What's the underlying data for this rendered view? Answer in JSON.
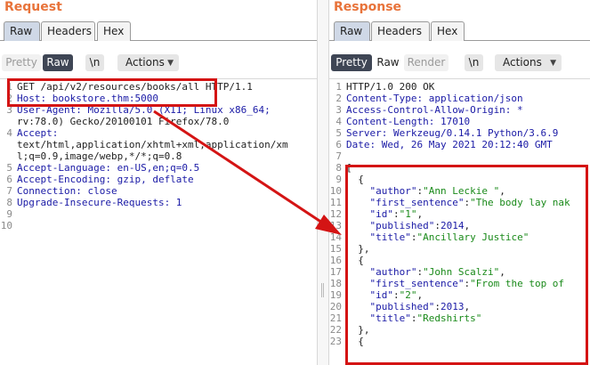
{
  "request": {
    "title": "Request",
    "tabs": [
      {
        "label": "Raw",
        "active": true
      },
      {
        "label": "Headers",
        "active": false
      },
      {
        "label": "Hex",
        "active": false
      }
    ],
    "view_buttons": [
      {
        "label": "Pretty",
        "state": "inactive"
      },
      {
        "label": "Raw",
        "state": "selected"
      }
    ],
    "newline_label": "\\n",
    "actions_label": "Actions",
    "lines": [
      {
        "n": "1",
        "text": "GET /api/v2/resources/books/all HTTP/1.1",
        "kind": "text"
      },
      {
        "n": "2",
        "text": "Host: bookstore.thm:5000",
        "kind": "header"
      },
      {
        "n": "3",
        "text": "User-Agent: Mozilla/5.0 (X11; Linux x86_64;",
        "kind": "header"
      },
      {
        "n": "",
        "text": "rv:78.0) Gecko/20100101 Firefox/78.0",
        "kind": "text"
      },
      {
        "n": "4",
        "text": "Accept:",
        "kind": "header"
      },
      {
        "n": "",
        "text": "text/html,application/xhtml+xml,application/xm",
        "kind": "text"
      },
      {
        "n": "",
        "text": "l;q=0.9,image/webp,*/*;q=0.8",
        "kind": "text"
      },
      {
        "n": "5",
        "text": "Accept-Language: en-US,en;q=0.5",
        "kind": "header"
      },
      {
        "n": "6",
        "text": "Accept-Encoding: gzip, deflate",
        "kind": "header"
      },
      {
        "n": "7",
        "text": "Connection: close",
        "kind": "header"
      },
      {
        "n": "8",
        "text": "Upgrade-Insecure-Requests: 1",
        "kind": "header"
      },
      {
        "n": "9",
        "text": "",
        "kind": "text"
      },
      {
        "n": "10",
        "text": "",
        "kind": "text"
      }
    ]
  },
  "response": {
    "title": "Response",
    "tabs": [
      {
        "label": "Raw",
        "active": true
      },
      {
        "label": "Headers",
        "active": false
      },
      {
        "label": "Hex",
        "active": false
      }
    ],
    "view_buttons": [
      {
        "label": "Pretty",
        "state": "selected"
      },
      {
        "label": "Raw",
        "state": "plain"
      },
      {
        "label": "Render",
        "state": "inactive"
      }
    ],
    "newline_label": "\\n",
    "actions_label": "Actions",
    "lines": [
      {
        "n": "1",
        "text": "HTTP/1.0 200 OK",
        "kind": "text"
      },
      {
        "n": "2",
        "text": "Content-Type: application/json",
        "kind": "header"
      },
      {
        "n": "3",
        "text": "Access-Control-Allow-Origin: *",
        "kind": "header"
      },
      {
        "n": "4",
        "text": "Content-Length: 17010",
        "kind": "header"
      },
      {
        "n": "5",
        "text": "Server: Werkzeug/0.14.1 Python/3.6.9",
        "kind": "header"
      },
      {
        "n": "6",
        "text": "Date: Wed, 26 May 2021 20:12:40 GMT",
        "kind": "header"
      },
      {
        "n": "7",
        "text": "",
        "kind": "text"
      },
      {
        "n": "8",
        "text": "[",
        "kind": "punc"
      },
      {
        "n": "9",
        "text": "  {",
        "kind": "punc"
      },
      {
        "n": "10",
        "key": "\"author\"",
        "val": "\"Ann Leckie \"",
        "vkind": "str",
        "tail": ",",
        "kind": "kv"
      },
      {
        "n": "11",
        "key": "\"first_sentence\"",
        "val": "\"The body lay nak",
        "vkind": "str",
        "tail": "",
        "kind": "kv"
      },
      {
        "n": "12",
        "key": "\"id\"",
        "val": "\"1\"",
        "vkind": "str",
        "tail": ",",
        "kind": "kv"
      },
      {
        "n": "13",
        "key": "\"published\"",
        "val": "2014",
        "vkind": "num",
        "tail": ",",
        "kind": "kv"
      },
      {
        "n": "14",
        "key": "\"title\"",
        "val": "\"Ancillary Justice\"",
        "vkind": "str",
        "tail": "",
        "kind": "kv"
      },
      {
        "n": "15",
        "text": "  },",
        "kind": "punc"
      },
      {
        "n": "16",
        "text": "  {",
        "kind": "punc"
      },
      {
        "n": "17",
        "key": "\"author\"",
        "val": "\"John Scalzi\"",
        "vkind": "str",
        "tail": ",",
        "kind": "kv"
      },
      {
        "n": "18",
        "key": "\"first_sentence\"",
        "val": "\"From the top of",
        "vkind": "str",
        "tail": "",
        "kind": "kv"
      },
      {
        "n": "19",
        "key": "\"id\"",
        "val": "\"2\"",
        "vkind": "str",
        "tail": ",",
        "kind": "kv"
      },
      {
        "n": "20",
        "key": "\"published\"",
        "val": "2013",
        "vkind": "num",
        "tail": ",",
        "kind": "kv"
      },
      {
        "n": "21",
        "key": "\"title\"",
        "val": "\"Redshirts\"",
        "vkind": "str",
        "tail": "",
        "kind": "kv"
      },
      {
        "n": "22",
        "text": "  },",
        "kind": "punc"
      },
      {
        "n": "23",
        "text": "  {",
        "kind": "punc"
      }
    ]
  },
  "annotation": {
    "color": "#d41414"
  }
}
